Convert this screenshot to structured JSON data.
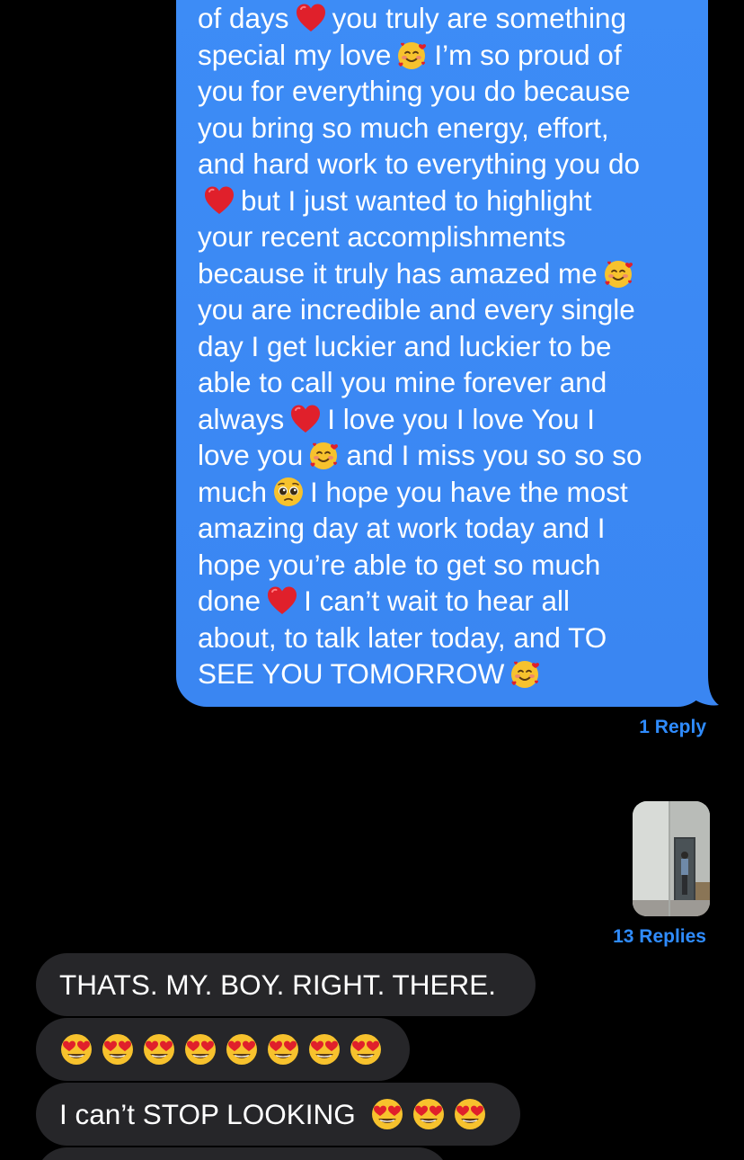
{
  "sent_message": {
    "lines": [
      {
        "parts": [
          "of days",
          "heart",
          "you truly are something"
        ]
      },
      {
        "parts": [
          "special my love",
          "smiling-hearts",
          "I’m so proud of"
        ]
      },
      {
        "parts": [
          "you for everything you do because"
        ]
      },
      {
        "parts": [
          "you bring so much energy, effort,"
        ]
      },
      {
        "parts": [
          "and hard work to everything you do"
        ]
      },
      {
        "parts": [
          "",
          "heart",
          "but I just wanted to highlight"
        ]
      },
      {
        "parts": [
          "your recent accomplishments"
        ]
      },
      {
        "parts": [
          "because it truly has amazed me",
          "smiling-hearts",
          ""
        ]
      },
      {
        "parts": [
          "you are incredible and every single"
        ]
      },
      {
        "parts": [
          "day I get luckier and luckier to be"
        ]
      },
      {
        "parts": [
          "able to call you mine forever and"
        ]
      },
      {
        "parts": [
          "always",
          "heart",
          "I love you I love You I"
        ]
      },
      {
        "parts": [
          "love you",
          "smiling-hearts",
          "and I miss you so so so"
        ]
      },
      {
        "parts": [
          "much",
          "pleading",
          "I hope you have the most"
        ]
      },
      {
        "parts": [
          "amazing day at work today and I"
        ]
      },
      {
        "parts": [
          "hope you’re able to get so much"
        ]
      },
      {
        "parts": [
          "done",
          "heart",
          "I can’t wait to hear all"
        ]
      },
      {
        "parts": [
          "about, to talk later today, and TO"
        ]
      },
      {
        "parts": [
          "SEE YOU TOMORROW",
          "smiling-hearts",
          ""
        ]
      }
    ],
    "reply_count": "1 Reply"
  },
  "photo_message": {
    "reply_count": "13 Replies"
  },
  "received_messages": [
    {
      "text": "THATS. MY. BOY. RIGHT. THERE.",
      "emoji_count": 0
    },
    {
      "text": "",
      "emoji_count": 8
    },
    {
      "text": "I can’t STOP LOOKING",
      "emoji_count": 3
    }
  ],
  "colors": {
    "sent_bubble": "#3a86f2",
    "received_bubble": "#262629",
    "reply_link": "#2f8cff",
    "background": "#000000"
  },
  "icons": {
    "heart": "red-heart-emoji",
    "smiling-hearts": "smiling-face-with-hearts-emoji",
    "pleading": "pleading-face-emoji",
    "heart-eyes": "heart-eyes-emoji"
  }
}
